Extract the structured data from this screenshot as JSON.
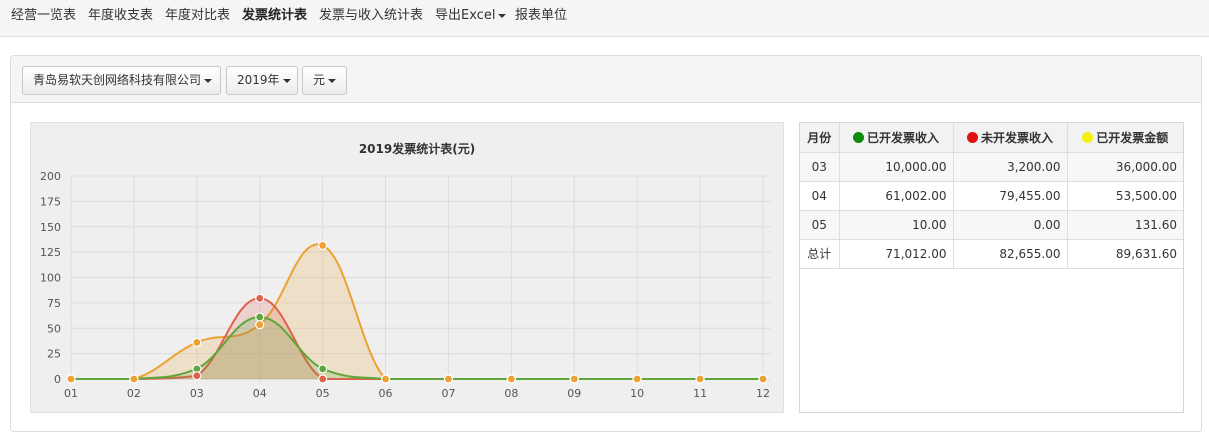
{
  "nav": {
    "items": [
      {
        "label": "经营一览表",
        "active": false
      },
      {
        "label": "年度收支表",
        "active": false
      },
      {
        "label": "年度对比表",
        "active": false
      },
      {
        "label": "发票统计表",
        "active": true
      },
      {
        "label": "发票与收入统计表",
        "active": false
      },
      {
        "label": "导出Excel",
        "active": false,
        "dropdown": true
      },
      {
        "label": "报表单位",
        "active": false
      }
    ]
  },
  "filters": {
    "company": "青岛易软天创网络科技有限公司",
    "year": "2019年",
    "unit": "元"
  },
  "table": {
    "headers": {
      "month": "月份",
      "invoiced": "已开发票收入",
      "uninvoiced": "未开发票收入",
      "amount": "已开发票金额"
    },
    "rows": [
      {
        "month": "03",
        "invoiced": "10,000.00",
        "uninvoiced": "3,200.00",
        "amount": "36,000.00"
      },
      {
        "month": "04",
        "invoiced": "61,002.00",
        "uninvoiced": "79,455.00",
        "amount": "53,500.00"
      },
      {
        "month": "05",
        "invoiced": "10.00",
        "uninvoiced": "0.00",
        "amount": "131.60"
      },
      {
        "month": "总计",
        "invoiced": "71,012.00",
        "uninvoiced": "82,655.00",
        "amount": "89,631.60"
      }
    ]
  },
  "colors": {
    "invoiced": "#5ea63b",
    "uninvoiced": "#e0614a",
    "amount": "#eda132",
    "legend_invoiced": "#0b8a0b",
    "legend_uninvoiced": "#e01010",
    "legend_amount": "#f6f10a"
  },
  "chart_data": {
    "type": "area",
    "title": "2019发票统计表(元)",
    "xlabel": "",
    "ylabel": "",
    "ylim": [
      0,
      200
    ],
    "yticks": [
      0,
      25,
      50,
      75,
      100,
      125,
      150,
      175,
      200
    ],
    "grid": true,
    "categories": [
      "01",
      "02",
      "03",
      "04",
      "05",
      "06",
      "07",
      "08",
      "09",
      "10",
      "11",
      "12"
    ],
    "series": [
      {
        "key": "invoiced",
        "values": [
          0,
          0,
          10,
          61,
          10,
          0,
          0,
          0,
          0,
          0,
          0,
          0
        ]
      },
      {
        "key": "uninvoiced",
        "values": [
          0,
          0,
          3.2,
          79.5,
          0,
          0,
          0,
          0,
          0,
          0,
          0,
          0
        ]
      },
      {
        "key": "amount",
        "values": [
          0,
          0,
          36,
          53.5,
          131.6,
          0,
          0,
          0,
          0,
          0,
          0,
          0
        ]
      }
    ]
  }
}
